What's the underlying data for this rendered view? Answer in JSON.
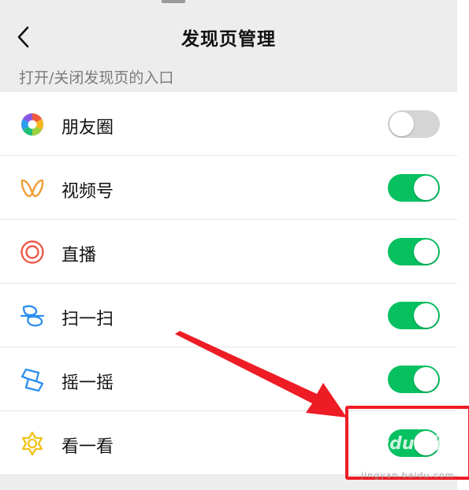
{
  "header": {
    "title": "发现页管理"
  },
  "subtitle": "打开/关闭发现页的入口",
  "items": [
    {
      "label": "朋友圈",
      "icon": "moments-icon",
      "enabled": false
    },
    {
      "label": "视频号",
      "icon": "channels-icon",
      "enabled": true
    },
    {
      "label": "直播",
      "icon": "live-icon",
      "enabled": true
    },
    {
      "label": "扫一扫",
      "icon": "scan-icon",
      "enabled": true
    },
    {
      "label": "摇一摇",
      "icon": "shake-icon",
      "enabled": true
    },
    {
      "label": "看一看",
      "icon": "top-stories-icon",
      "enabled": true
    }
  ],
  "colors": {
    "toggle_on": "#07c160",
    "toggle_off": "#d5d5d5",
    "annotation": "#ee1c25"
  },
  "watermark": {
    "brand": "Baidu经验",
    "url": "jingyan.baidu.com"
  }
}
